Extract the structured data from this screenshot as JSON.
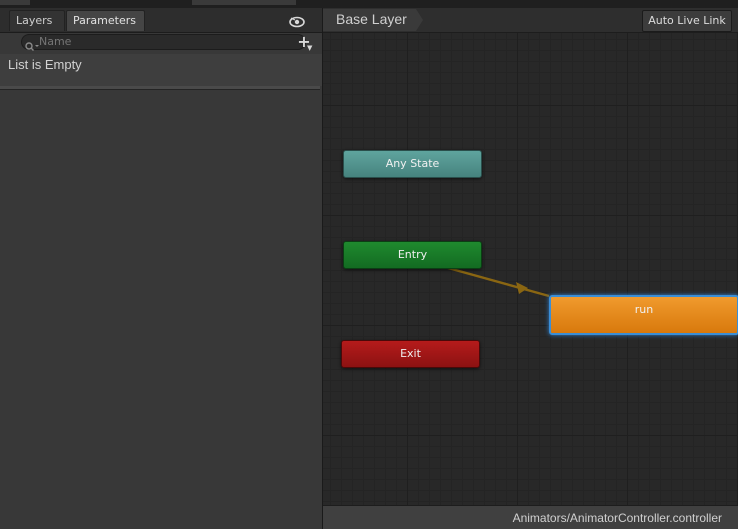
{
  "left_panel": {
    "tabs": [
      {
        "label": "Layers"
      },
      {
        "label": "Parameters"
      }
    ],
    "eye_icon": "eye-icon",
    "search": {
      "placeholder": "Name",
      "value": ""
    },
    "add_label": "+",
    "empty_text": "List is Empty"
  },
  "graph": {
    "breadcrumb": "Base Layer",
    "live_link_label": "Auto Live Link",
    "nodes": {
      "any_state": "Any State",
      "entry": "Entry",
      "exit": "Exit",
      "run": "run"
    },
    "transition_color": "#8a6612",
    "status_path": "Animators/AnimatorController.controller"
  },
  "colors": {
    "any_state": "#54958f",
    "entry": "#1a7d28",
    "exit": "#a21717",
    "run": "#e4870f",
    "selection": "#3a8ed6"
  }
}
